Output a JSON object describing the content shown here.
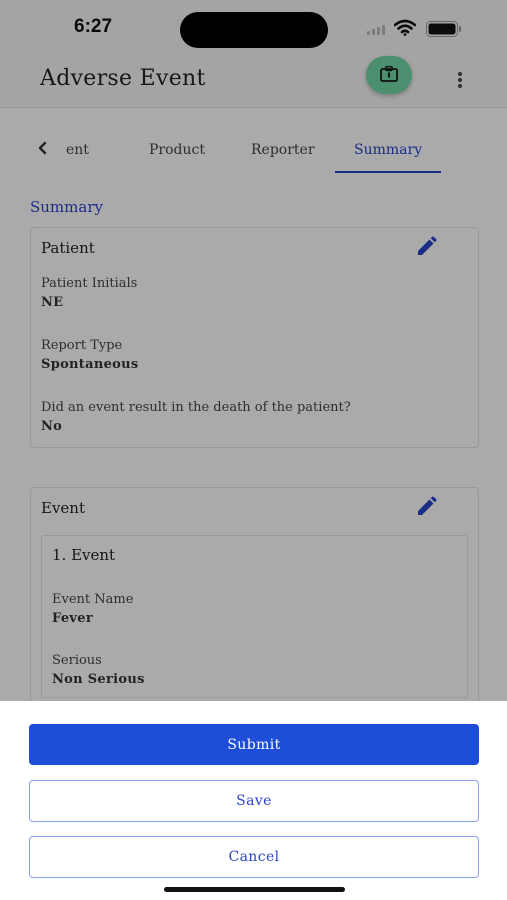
{
  "status_bar": {
    "time": "6:27"
  },
  "app_bar": {
    "title": "Adverse Event",
    "fab_icon": "badge-icon",
    "more_icon": "more-vertical-icon"
  },
  "tabs": {
    "items": [
      {
        "label": "ent"
      },
      {
        "label": "Product"
      },
      {
        "label": "Reporter"
      },
      {
        "label": "Summary",
        "active": true
      }
    ]
  },
  "summary": {
    "heading": "Summary",
    "patient_card": {
      "title": "Patient",
      "fields": [
        {
          "label": "Patient Initials",
          "value": "NE"
        },
        {
          "label": "Report Type",
          "value": "Spontaneous"
        },
        {
          "label": "Did an event result in the death of the patient?",
          "value": "No"
        }
      ]
    },
    "event_card": {
      "title": "Event",
      "event": {
        "title": "1. Event",
        "fields": [
          {
            "label": "Event Name",
            "value": "Fever"
          },
          {
            "label": "Serious",
            "value": "Non Serious"
          }
        ]
      }
    }
  },
  "actions": {
    "submit": "Submit",
    "save": "Save",
    "cancel": "Cancel"
  },
  "colors": {
    "accent": "#2a43c6",
    "primary_button": "#1e4ed8",
    "fab": "#6fd3a4"
  }
}
